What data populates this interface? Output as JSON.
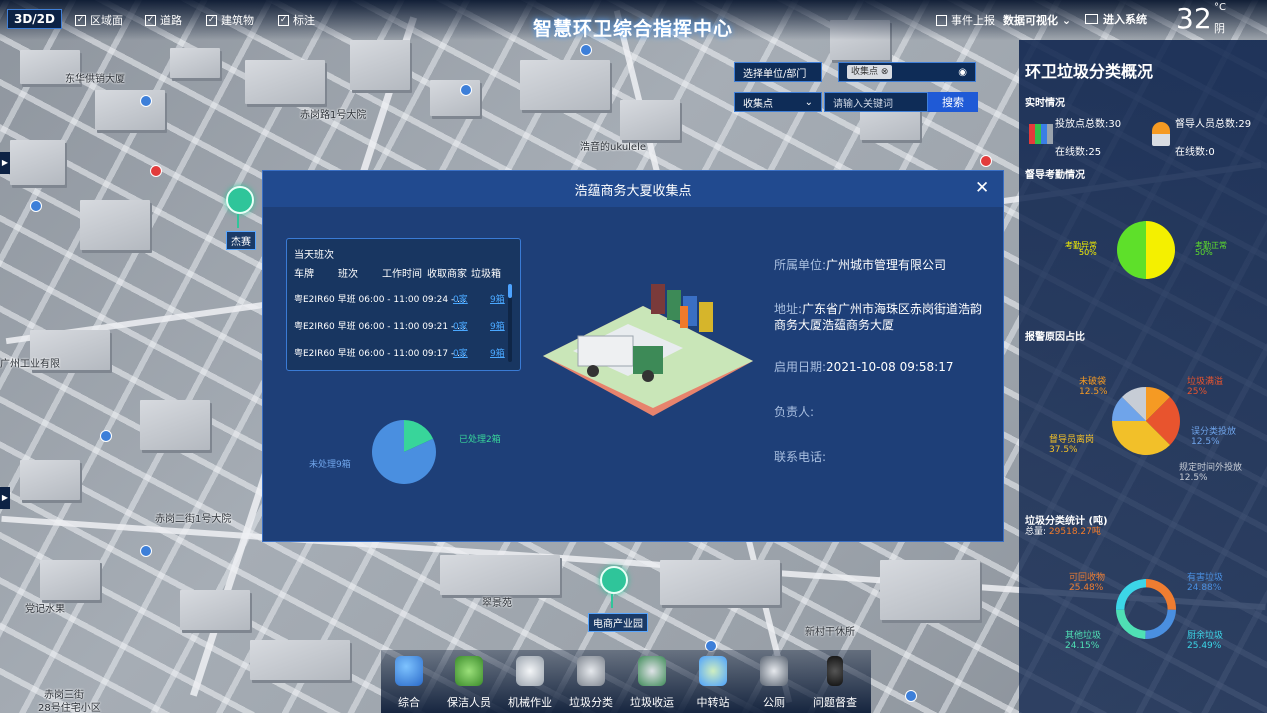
{
  "header": {
    "mode_toggle": "3D/2D",
    "layers": [
      "区域面",
      "道路",
      "建筑物",
      "标注"
    ],
    "title": "智慧环卫综合指挥中心",
    "event_report": "事件上报",
    "data_viz": "数据可视化",
    "enter_system": "进入系统",
    "temperature": "32",
    "temp_unit": "°C",
    "weather": "阴"
  },
  "search": {
    "unit_placeholder": "选择单位/部门",
    "tag": "收集点",
    "category": "收集点",
    "keyword_placeholder": "请输入关键词",
    "button": "搜索"
  },
  "map_labels": {
    "marker_top": "杰赛",
    "marker_bottom": "电商产业园",
    "ukulele": "浩音的ukulele",
    "street": "赤岗三街",
    "building": "28号住宅小区",
    "hospital": "新村干休所",
    "road1": "赤岗路1号大院",
    "road2": "赤岗二街1号大院",
    "north": "翠景苑",
    "left1": "东华供销大厦",
    "left2": "广州工业有限",
    "left3": "党记水果"
  },
  "modal": {
    "title": "浩蕴商务大夏收集点",
    "close": "✕",
    "shift_card": {
      "title": "当天班次",
      "headers": [
        "车牌",
        "班次",
        "工作时间",
        "收取商家",
        "垃圾箱"
      ],
      "rows": [
        {
          "text": "粤E2IR60 早班 06:00 - 11:00 09:24 - ...",
          "merchants": "0家",
          "bins": "9箱"
        },
        {
          "text": "粤E2IR60 早班 06:00 - 11:00 09:21 - ...",
          "merchants": "0家",
          "bins": "9箱"
        },
        {
          "text": "粤E2IR60 早班 06:00 - 11:00 09:17 - ...",
          "merchants": "0家",
          "bins": "9箱"
        }
      ]
    },
    "pie": {
      "processed_label": "已处理2箱",
      "unprocessed_label": "未处理9箱",
      "processed": 2,
      "unprocessed": 9,
      "processed_color": "#38d59a",
      "unprocessed_color": "#4a8fe0"
    },
    "info": {
      "unit_key": "所属单位:",
      "unit_val": "广州城市管理有限公司",
      "addr_key": "地址:",
      "addr_val": "广东省广州市海珠区赤岗街道浩韵商务大厦浩蕴商务大厦",
      "date_key": "启用日期:",
      "date_val": "2021-10-08 09:58:17",
      "owner_key": "负责人:",
      "phone_key": "联系电话:"
    }
  },
  "right_panel": {
    "title": "环卫垃圾分类概况",
    "realtime": "实时情况",
    "drop_points": "投放点总数:30",
    "supervisors": "督导人员总数:29",
    "online1": "在线数:25",
    "online2": "在线数:0",
    "attendance_title": "督导考勤情况",
    "att_abnormal": "考勤异常",
    "att_abnormal_pct": "50%",
    "att_normal": "考勤正常",
    "att_normal_pct": "50%",
    "alarm_title": "报警原因占比",
    "alarm_labels": [
      {
        "name": "未破袋",
        "pct": "12.5%"
      },
      {
        "name": "垃圾满溢",
        "pct": "25%"
      },
      {
        "name": "督导员离岗",
        "pct": "37.5%"
      },
      {
        "name": "误分类投放",
        "pct": "12.5%"
      },
      {
        "name": "规定时间外投放",
        "pct": "12.5%"
      }
    ],
    "stats_title": "垃圾分类统计 (吨)",
    "stats_total_key": "总量:",
    "stats_total_val": "29518.27吨",
    "stats_labels": [
      {
        "name": "可回收物",
        "pct": "25.48%"
      },
      {
        "name": "有害垃圾",
        "pct": "24.88%"
      },
      {
        "name": "其他垃圾",
        "pct": "24.15%"
      },
      {
        "name": "厨余垃圾",
        "pct": "25.49%"
      }
    ],
    "colors": {
      "att_abnormal": "#f4f000",
      "att_normal": "#5ee02a"
    }
  },
  "chart_data": [
    {
      "type": "pie",
      "categories": [
        "已处理",
        "未处理"
      ],
      "values": [
        2,
        9
      ]
    },
    {
      "type": "pie",
      "categories": [
        "考勤异常",
        "考勤正常"
      ],
      "values": [
        50,
        50
      ]
    },
    {
      "type": "pie",
      "categories": [
        "未破袋",
        "垃圾满溢",
        "督导员离岗",
        "误分类投放",
        "规定时间外投放"
      ],
      "values": [
        12.5,
        25,
        37.5,
        12.5,
        12.5
      ]
    },
    {
      "type": "pie",
      "categories": [
        "可回收物",
        "有害垃圾",
        "其他垃圾",
        "厨余垃圾"
      ],
      "values": [
        25.48,
        24.88,
        24.15,
        25.49
      ]
    }
  ],
  "bottom_nav": [
    "综合",
    "保洁人员",
    "机械作业",
    "垃圾分类",
    "垃圾收运",
    "中转站",
    "公厕",
    "问题督查"
  ]
}
